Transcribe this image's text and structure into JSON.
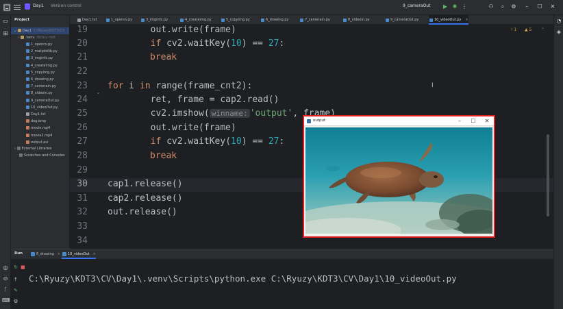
{
  "titlebar": {
    "project_badge": "D",
    "project_name": "Day1",
    "vcs_label": "Version control",
    "run_config": "9_cameraOut",
    "icons": [
      "app-logo-icon",
      "hamburger-menu-icon",
      "run-icon",
      "debug-icon",
      "more-icon",
      "user-icon",
      "search-icon",
      "settings-icon",
      "minimize-icon",
      "maximize-icon",
      "close-icon"
    ]
  },
  "project_panel": {
    "title": "Project",
    "root": {
      "name": "Day1",
      "hint": "C:\\Ryuzy\\KDT3\\CV"
    },
    "venv": {
      "name": ".venv",
      "hint": "library root"
    },
    "files": [
      "1_opencv.py",
      "2_matplotlib.py",
      "3_imginfo.py",
      "4_createimg.py",
      "5_copyimg.py",
      "6_drawing.py",
      "7_camerain.py",
      "8_videoin.py",
      "9_cameraOut.py",
      "10_videoOut.py",
      "Day1.txt",
      "dog.bmp",
      "movie.mp4",
      "movie2.mp4",
      "output.avi"
    ],
    "external": "External Libraries",
    "scratches": "Scratches and Consoles"
  },
  "tabs": [
    {
      "label": "Day1.txt",
      "kind": "txt"
    },
    {
      "label": "1_opencv.py",
      "kind": "py"
    },
    {
      "label": "3_imginfo.py",
      "kind": "py"
    },
    {
      "label": "4_createimg.py",
      "kind": "py"
    },
    {
      "label": "5_copyimg.py",
      "kind": "py"
    },
    {
      "label": "6_drawing.py",
      "kind": "py"
    },
    {
      "label": "7_camerain.py",
      "kind": "py"
    },
    {
      "label": "8_videoin.py",
      "kind": "py"
    },
    {
      "label": "9_cameraOut.py",
      "kind": "py"
    },
    {
      "label": "10_videoOut.py",
      "kind": "py",
      "active": true,
      "close": "×"
    }
  ],
  "editor": {
    "line_numbers": [
      "19",
      "20",
      "21",
      "22",
      "23",
      "24",
      "25",
      "26",
      "27",
      "28",
      "29",
      "30",
      "31",
      "32",
      "33",
      "34"
    ],
    "current_line": "30",
    "warning_count": "1",
    "warning_count_2": "5",
    "lines": {
      "l19": "        out.write(frame)",
      "l20_a": "        ",
      "l20_kw": "if",
      "l20_b": " cv2.waitKey(",
      "l20_num": "10",
      "l20_c": ") == ",
      "l20_num2": "27",
      "l20_d": ":",
      "l21_kw": "break",
      "l23_kw1": "for",
      "l23_b": " i ",
      "l23_kw2": "in",
      "l23_c": " range(frame_cnt2):",
      "l24": "        ret, frame = cap2.read()",
      "l25_a": "        cv2.imshow(",
      "l25_hint": "winname:",
      "l25_str": "'output'",
      "l25_b": ", frame)",
      "l26": "        out.write(frame)",
      "l27_a": "        ",
      "l27_kw": "if",
      "l27_b": " cv2.waitKey(",
      "l27_num": "10",
      "l27_c": ") == ",
      "l27_num2": "27",
      "l27_d": ":",
      "l28_kw": "break",
      "l30": "cap1.release()",
      "l31": "cap2.release()",
      "l32": "out.release()"
    }
  },
  "run_panel": {
    "label": "Run",
    "tabs": [
      {
        "label": "6_drawing",
        "close": "×"
      },
      {
        "label": "10_videoOut",
        "close": "×",
        "active": true
      }
    ],
    "console": "C:\\Ryuzy\\KDT3\\CV\\Day1\\.venv\\Scripts\\python.exe C:\\Ryuzy\\KDT3\\CV\\Day1\\10_videoOut.py"
  },
  "output_window": {
    "title": "output",
    "minimize": "–",
    "maximize": "☐",
    "close": "✕",
    "frame": "sea-turtle-underwater-video-frame"
  },
  "colors": {
    "accent": "#3574f0",
    "highlight_border": "#e02020",
    "keyword": "#cf8e6d",
    "number": "#2aacb8",
    "string": "#6aab73"
  }
}
